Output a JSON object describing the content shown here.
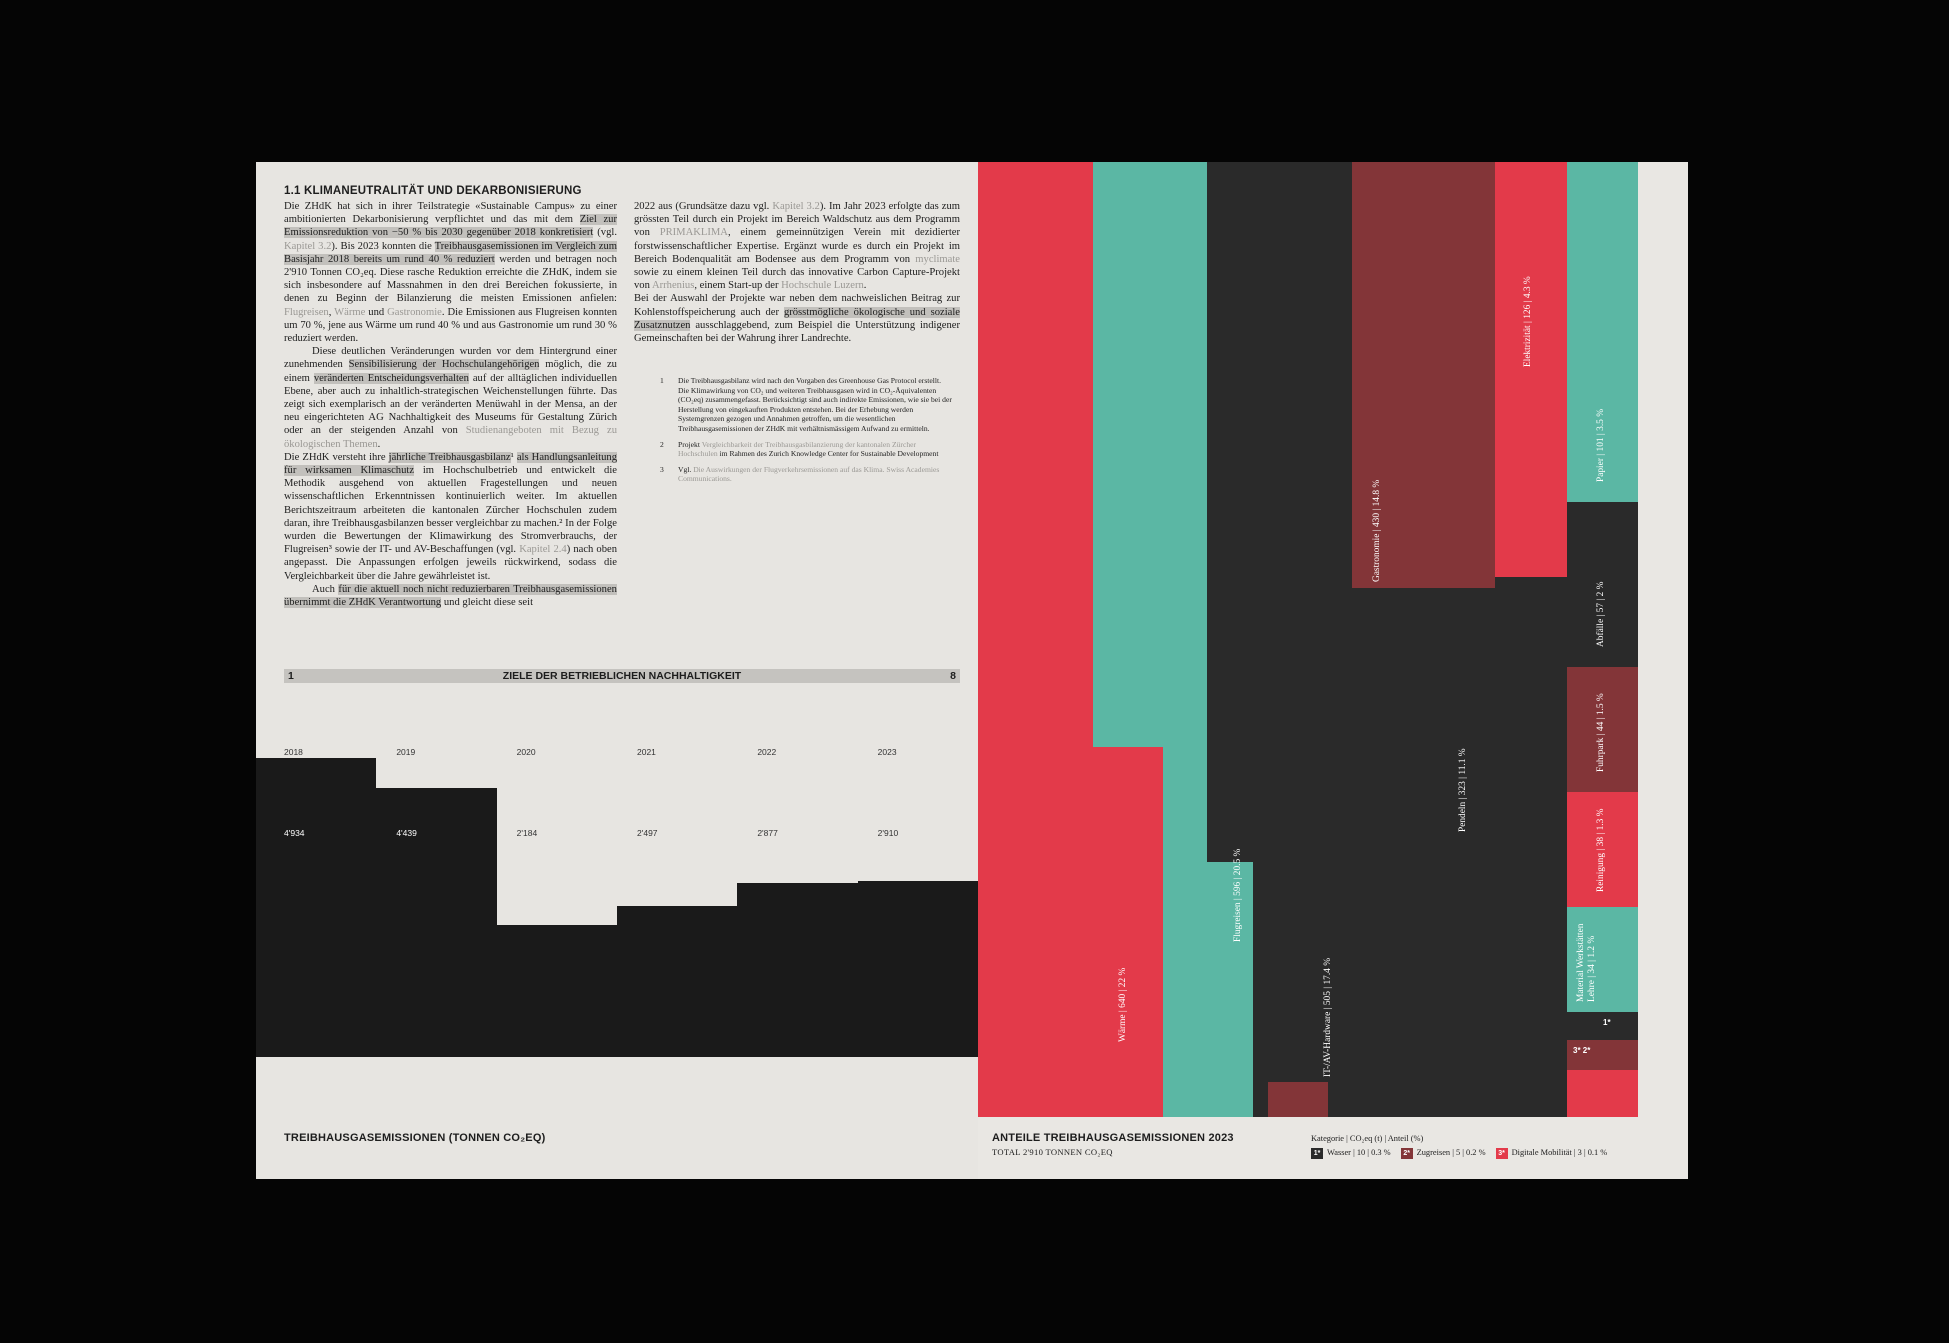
{
  "left": {
    "section_title": "1.1 KLIMANEUTRALITÄT UND DEKARBONISIERUNG",
    "col1": [
      {
        "cls": "",
        "runs": [
          {
            "t": "Die ZHdK hat sich in ihrer Teilstrategie «Sustainable Campus» zu einer ambitionierten Dekarbonisierung verpflichtet und das mit dem "
          },
          {
            "t": "Ziel zur Emissionsreduktion von −50 % bis 2030 gegenüber 2018 konkretisiert",
            "s": "hl"
          },
          {
            "t": " (vgl. "
          },
          {
            "t": "Kapitel 3.2",
            "s": "lk"
          },
          {
            "t": "). Bis 2023 konnten die "
          },
          {
            "t": "Treibhausgasemissionen im Vergleich zum Basisjahr 2018 bereits um rund 40 % reduziert",
            "s": "hl"
          },
          {
            "t": " werden und betragen noch 2'910 Tonnen CO₂eq. Diese rasche Reduktion erreichte die ZHdK, indem sie sich insbesondere auf Massnahmen in den drei Bereichen fokussierte, in denen zu Beginn der Bilanzierung die meisten Emissionen anfielen: "
          },
          {
            "t": "Flugreisen",
            "s": "lk"
          },
          {
            "t": ", "
          },
          {
            "t": "Wärme",
            "s": "lk"
          },
          {
            "t": " und "
          },
          {
            "t": "Gastronomie",
            "s": "lk"
          },
          {
            "t": ". Die Emissionen aus Flugreisen konnten um 70 %, jene aus Wärme um rund 40 % und aus Gastronomie um rund 30 % reduziert werden."
          }
        ]
      },
      {
        "cls": "ind",
        "runs": [
          {
            "t": "Diese deutlichen Veränderungen wurden vor dem Hintergrund einer zunehmenden "
          },
          {
            "t": "Sensibilisierung der Hochschulangehörigen",
            "s": "hl"
          },
          {
            "t": " möglich, die zu einem "
          },
          {
            "t": "veränderten Entscheidungsverhalten",
            "s": "hl"
          },
          {
            "t": " auf der alltäglichen individuellen Ebene, aber auch zu inhaltlich-strategischen Weichenstellungen führte. Das zeigt sich exemplarisch an der veränderten Menüwahl in der Mensa, an der neu eingerichteten AG Nachhaltigkeit des Museums für Gestaltung Zürich oder an der steigenden Anzahl von "
          },
          {
            "t": "Studienangeboten mit Bezug zu ökologischen Themen",
            "s": "lk"
          },
          {
            "t": "."
          }
        ]
      },
      {
        "cls": "",
        "runs": [
          {
            "t": "Die ZHdK versteht ihre "
          },
          {
            "t": "jährliche Treibhausgasbilanz",
            "s": "hl"
          },
          {
            "t": "¹ "
          },
          {
            "t": "als Handlungsanleitung für wirksamen Klimaschutz",
            "s": "hl"
          },
          {
            "t": " im Hochschulbetrieb und entwickelt die Methodik ausgehend von aktuellen Fragestellungen und neuen wissenschaftlichen Erkenntnissen kontinuierlich weiter. Im aktuellen Berichtszeitraum arbeiteten die kantonalen Zürcher Hochschulen zudem daran, ihre Treibhausgasbilanzen besser vergleichbar zu machen.² In der Folge wurden die Bewertungen der Klimawirkung des Stromverbrauchs, der Flugreisen³ sowie der IT- und AV-Beschaffungen (vgl. "
          },
          {
            "t": "Kapitel 2.4",
            "s": "lk"
          },
          {
            "t": ") nach oben angepasst. Die Anpassungen erfolgen jeweils rückwirkend, sodass die Vergleichbarkeit über die Jahre gewährleistet ist."
          }
        ]
      },
      {
        "cls": "ind",
        "runs": [
          {
            "t": "Auch "
          },
          {
            "t": "für die aktuell noch nicht reduzierbaren Treibhausgasemissionen übernimmt die ZHdK Verantwortung",
            "s": "hl"
          },
          {
            "t": " und gleicht diese seit"
          }
        ]
      }
    ],
    "col2": [
      {
        "cls": "",
        "runs": [
          {
            "t": "2022 aus (Grundsätze dazu vgl. "
          },
          {
            "t": "Kapitel 3.2",
            "s": "lk"
          },
          {
            "t": "). Im Jahr 2023 erfolgte das zum grössten Teil durch ein Projekt im Bereich Waldschutz aus dem Programm von "
          },
          {
            "t": "PRIMAKLIMA",
            "s": "lk"
          },
          {
            "t": ", einem gemeinnützigen Verein mit dezidierter forstwissenschaftlicher Expertise. Ergänzt wurde es durch ein Projekt im Bereich Bodenqualität am Bodensee aus dem Programm von "
          },
          {
            "t": "myclimate",
            "s": "lk"
          },
          {
            "t": " sowie zu einem kleinen Teil durch das innovative Carbon Capture-Projekt von "
          },
          {
            "t": "Arrhenius",
            "s": "lk"
          },
          {
            "t": ", einem Start-up der "
          },
          {
            "t": "Hochschule Luzern",
            "s": "lk"
          },
          {
            "t": "."
          }
        ]
      },
      {
        "cls": "",
        "runs": [
          {
            "t": "Bei der Auswahl der Projekte war neben dem nachweislichen Beitrag zur Kohlenstoffspeicherung auch der "
          },
          {
            "t": "grösstmögliche ökologische und soziale Zusatznutzen",
            "s": "hl"
          },
          {
            "t": " ausschlaggebend, zum Beispiel die Unterstützung indigener Gemeinschaften bei der Wahrung ihrer Landrechte."
          }
        ]
      }
    ],
    "footnotes": [
      {
        "n": "1",
        "runs": [
          {
            "t": "Die Treibhausgasbilanz wird nach den Vorgaben des Greenhouse Gas Protocol erstellt. Die Klimawirkung von CO₂ und weiteren Treibhausgasen wird in CO₂-Äquivalenten (CO₂eq) zusammengefasst. Berücksichtigt sind auch indirekte Emissionen, wie sie bei der Herstellung von eingekauften Produkten entstehen. Bei der Erhebung werden Systemgrenzen gezogen und Annahmen getroffen, um die wesentlichen Treibhausgasemissionen der ZHdK mit verhältnismässigem Aufwand zu ermitteln."
          }
        ]
      },
      {
        "n": "2",
        "runs": [
          {
            "t": "Projekt "
          },
          {
            "t": "Vergleichbarkeit der Treibhausgasbilanzierung der kantonalen Zürcher Hochschulen",
            "s": "lk"
          },
          {
            "t": " im Rahmen des Zurich Knowledge Center for Sustainable Development"
          }
        ]
      },
      {
        "n": "3",
        "runs": [
          {
            "t": "Vgl. "
          },
          {
            "t": "Die Auswirkungen der Flugverkehrsemissionen auf das Klima. Swiss Academies Communications.",
            "s": "lk"
          }
        ]
      }
    ],
    "footer": {
      "left": "1",
      "center": "ZIELE DER BETRIEBLICHEN NACHHALTIGKEIT",
      "right": "8"
    },
    "chart_caption": "TREIBHAUSGASEMISSIONEN (TONNEN CO₂EQ)"
  },
  "chart_data": [
    {
      "type": "bar",
      "title": "TREIBHAUSGASEMISSIONEN (TONNEN CO₂EQ)",
      "categories": [
        "2018",
        "2019",
        "2020",
        "2021",
        "2022",
        "2023"
      ],
      "values": [
        4934,
        4439,
        2184,
        2497,
        2877,
        2910
      ],
      "value_labels": [
        "4'934",
        "4'439",
        "2'184",
        "2'497",
        "2'877",
        "2'910"
      ],
      "color": "#1a1a1a"
    },
    {
      "type": "bar",
      "title": "ANTEILE TREIBHAUSGASEMISSIONEN 2023",
      "subtitle": "TOTAL 2'910 TONNEN CO₂EQ",
      "legend_header": "Kategorie  |  CO₂eq (t)  |  Anteil (%)",
      "series": [
        {
          "name": "Wärme",
          "value": 640,
          "share": "22 %",
          "color": "#e33a4a"
        },
        {
          "name": "Flugreisen",
          "value": 596,
          "share": "20.5 %",
          "color": "#5bb7a4"
        },
        {
          "name": "IT-/AV-Hardware",
          "value": 505,
          "share": "17.4 %",
          "color": "#2a2a2a"
        },
        {
          "name": "Gastronomie",
          "value": 430,
          "share": "14.8 %",
          "color": "#833538"
        },
        {
          "name": "Pendeln",
          "value": 323,
          "share": "11.1 %",
          "color": "#2a2a2a"
        },
        {
          "name": "Elektrizität",
          "value": 126,
          "share": "4.3 %",
          "color": "#e33a4a"
        },
        {
          "name": "Papier",
          "value": 101,
          "share": "3.5 %",
          "color": "#5bb7a4"
        },
        {
          "name": "Abfälle",
          "value": 57,
          "share": "2 %",
          "color": "#2a2a2a"
        },
        {
          "name": "Fuhrpark",
          "value": 44,
          "share": "1.5 %",
          "color": "#833538"
        },
        {
          "name": "Reinigung",
          "value": 38,
          "share": "1.3 %",
          "color": "#e33a4a"
        },
        {
          "name": "Material Werkstätten Lehre",
          "value": 34,
          "share": "1.2 %",
          "color": "#5bb7a4"
        },
        {
          "name": "Wasser",
          "value": 10,
          "share": "0.3 %",
          "color": "#2a2a2a",
          "chip": "1*"
        },
        {
          "name": "Zugreisen",
          "value": 5,
          "share": "0.2 %",
          "color": "#833538",
          "chip": "2*"
        },
        {
          "name": "Digitale Mobilität",
          "value": 3,
          "share": "0.1 %",
          "color": "#e33a4a",
          "chip": "3*"
        }
      ]
    }
  ],
  "right": {
    "caption_title": "ANTEILE TREIBHAUSGASEMISSIONEN 2023",
    "caption_sub": "TOTAL 2'910 TONNEN CO₂EQ",
    "legend_header": "Kategorie  |  CO₂eq (t)  |  Anteil (%)",
    "legend_items": [
      "Wasser  |  10  |  0.3 %",
      "Zugreisen  |  5  |  0.2 %",
      "Digitale Mobilität  |  3  |  0.1 %"
    ],
    "legend_chips": [
      "1*",
      "2*",
      "3*"
    ],
    "small_chips": [
      "1*",
      "3* 2*"
    ]
  }
}
